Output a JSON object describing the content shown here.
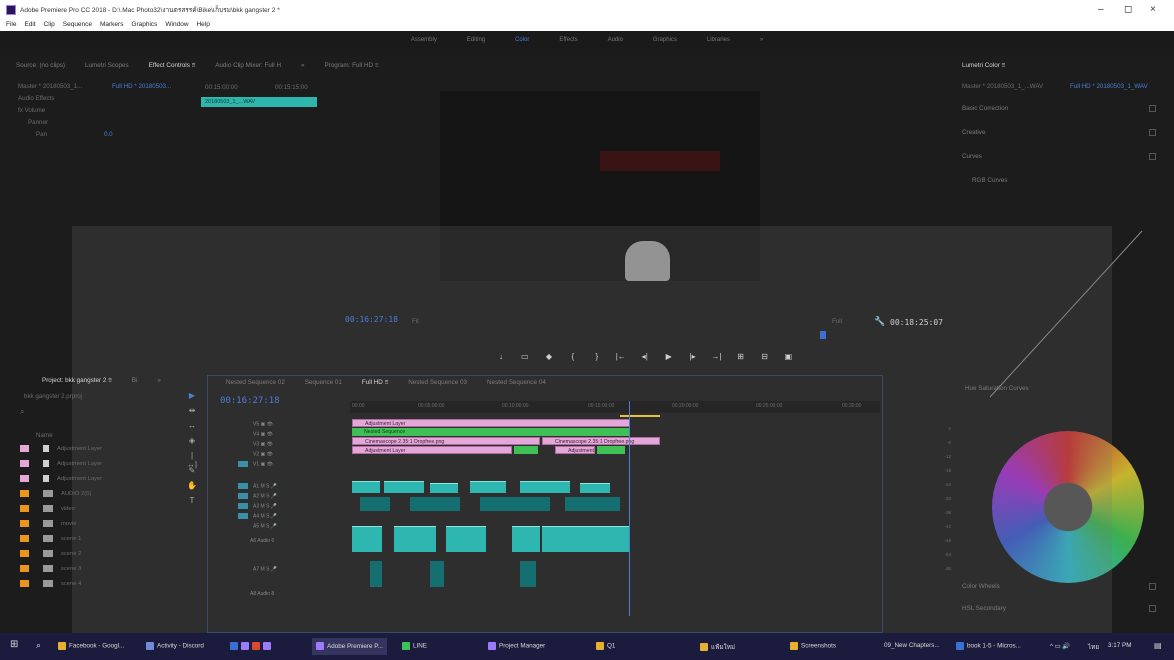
{
  "window": {
    "title": "Adobe Premiere Pro CC 2018 - D:\\.Mac Photo32\\งานตรสรรค์\\Bike\\เก็บรม\\bkk gangster 2 *",
    "min": "–",
    "max": "◻",
    "close": "×"
  },
  "menu": [
    "File",
    "Edit",
    "Clip",
    "Sequence",
    "Markers",
    "Graphics",
    "Window",
    "Help"
  ],
  "workspaces": {
    "items": [
      "Assembly",
      "Editing",
      "Color",
      "Effects",
      "Audio",
      "Graphics",
      "Libraries",
      "»"
    ],
    "active": "Color"
  },
  "source_tabs": [
    "Source: (no clips)",
    "Lumetri Scopes",
    "Effect Controls ≡",
    "Audio Clip Mixer: Full H",
    "»",
    "Program: Full HD ≡"
  ],
  "effect_controls": {
    "master": "Master * 20180503_1...",
    "sequence": "Full HD * 20180503...",
    "section": "Audio Effects",
    "fx": "fx  Volume",
    "panner": "Panner",
    "pan": "Pan",
    "pan_value": "0.0",
    "tc_a": "00:15:00:00",
    "tc_b": "00:15:15:00",
    "clip_name": "20180503_1_...WAV"
  },
  "program": {
    "timecode_in": "00:16:27:18",
    "fit": "Fit",
    "quality": "Full",
    "duration": "00:18:25:07"
  },
  "transport": [
    "↓",
    "▭",
    "◆",
    "{",
    "}",
    "|←",
    "◂|",
    "▶",
    "|▸",
    "→|",
    "⊞",
    "⊟",
    "▣"
  ],
  "project": {
    "tabs": [
      "Project: bkk gangster 2 ≡",
      "Bi",
      "»"
    ],
    "path": "bkk gangster 2.prproj",
    "column": "Name",
    "items": [
      {
        "name": "Adjustment Layer",
        "color": "#e3a8d8",
        "kind": "file"
      },
      {
        "name": "Adjustment Layer",
        "color": "#e3a8d8",
        "kind": "file"
      },
      {
        "name": "Adjustment Layer",
        "color": "#e3a8d8",
        "kind": "file"
      },
      {
        "name": "AUDIO 2(5)",
        "color": "#e8961e",
        "kind": "bin"
      },
      {
        "name": "video",
        "color": "#e8961e",
        "kind": "bin"
      },
      {
        "name": "movie",
        "color": "#e8961e",
        "kind": "bin"
      },
      {
        "name": "scene 1",
        "color": "#e8961e",
        "kind": "bin"
      },
      {
        "name": "scene 2",
        "color": "#e8961e",
        "kind": "bin"
      },
      {
        "name": "scene 3",
        "color": "#e8961e",
        "kind": "bin"
      },
      {
        "name": "scene 4",
        "color": "#e8961e",
        "kind": "bin"
      }
    ]
  },
  "tools": [
    "▶",
    "⇹",
    "↔",
    "◈",
    "|↔|",
    "✎",
    "✋",
    "T"
  ],
  "timeline": {
    "tabs": [
      "Nested Sequence 02",
      "Sequence 01",
      "Full HD ≡",
      "Nested Sequence 03",
      "Nested Sequence 04"
    ],
    "timecode": "00:16:27:18",
    "ruler": [
      "00:00",
      "00:05:00:00",
      "00:10:00:00",
      "00:15:00:00",
      "00:20:00:00",
      "00:25:00:00",
      "00:30:00"
    ],
    "video_tracks": [
      "V5",
      "V4",
      "V3",
      "V2",
      "V1"
    ],
    "audio_tracks": [
      "A1",
      "A2",
      "A3",
      "A4",
      "A5",
      "A6",
      "A7",
      "A8"
    ],
    "audio_label_a": "Audio 6",
    "audio_label_b": "Audio 8",
    "clips": {
      "adj1": "Adjustment Layer",
      "nested": "Nested Sequence",
      "cine1": "Cinemascope 2.35:1 Dropfree.png",
      "cine2": "Cinemascope 2.35:1 Dropfree.png",
      "adj2": "Adjustment Layer",
      "adj3": "Adjustment L"
    }
  },
  "lumetri": {
    "tab": "Lumetri Color ≡",
    "master": "Master * 20180503_1_...WAV",
    "sequence": "Full HD * 20180503_1_WAV",
    "sections": [
      "Basic Correction",
      "Creative",
      "Curves",
      "RGB Curves"
    ],
    "hue_sat": "Hue Saturation Curves",
    "wheels": "Color Wheels",
    "hsl": "HSL Secondary"
  },
  "meter": [
    "0",
    "-6",
    "-12",
    "-18",
    "-24",
    "-30",
    "-36",
    "-42",
    "-48",
    "-54",
    "dB"
  ],
  "taskbar": {
    "apps": [
      {
        "label": "Facebook - Googl...",
        "color": "#e8b030"
      },
      {
        "label": "Activity - Discord",
        "color": "#7289da"
      },
      {
        "label": "Adobe Premiere P...",
        "color": "#9b7cff"
      },
      {
        "label": "LINE",
        "color": "#3fc056"
      },
      {
        "label": "Project Manager",
        "color": "#9b7cff"
      },
      {
        "label": "Q1",
        "color": "#e8b030"
      },
      {
        "label": "แฟ้มใหม่",
        "color": "#e8b030"
      },
      {
        "label": "Screenshots",
        "color": "#e8b030"
      },
      {
        "label": "09_New Chapters...",
        "color": "#ffffff"
      },
      {
        "label": "book 1-5 - Micros...",
        "color": "#3a6fd4"
      }
    ],
    "lang": "ไทย",
    "time": "3:17 PM"
  }
}
